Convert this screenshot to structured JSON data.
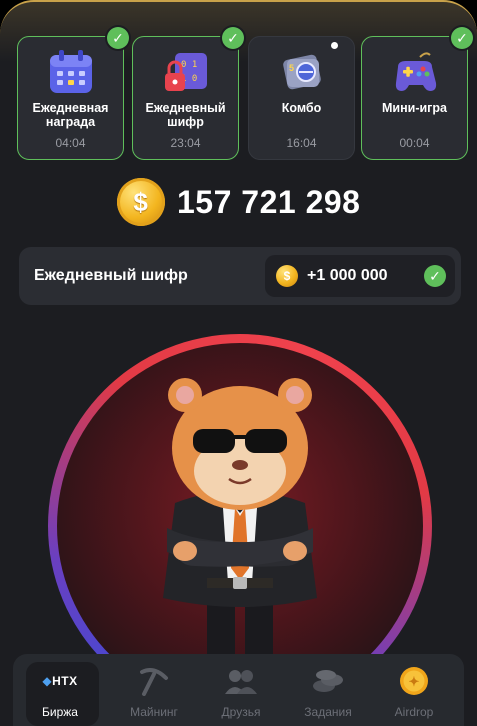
{
  "daily": {
    "cards": [
      {
        "label": "Ежедневная награда",
        "time": "04:04",
        "completed": true,
        "icon": "calendar-icon"
      },
      {
        "label": "Ежедневный шифр",
        "time": "23:04",
        "completed": true,
        "icon": "cipher-lock-icon"
      },
      {
        "label": "Комбо",
        "time": "16:04",
        "completed": false,
        "icon": "combo-card-icon"
      },
      {
        "label": "Мини-игра",
        "time": "00:04",
        "completed": true,
        "icon": "gamepad-icon"
      }
    ]
  },
  "balance": {
    "coin_symbol": "$",
    "amount": "157 721 298"
  },
  "cipher": {
    "title": "Ежедневный шифр",
    "reward": "+1 000 000",
    "coin_symbol": "$",
    "claimed": true
  },
  "nav": {
    "items": [
      {
        "label": "Биржа",
        "brand": "HTX",
        "active": true,
        "icon": "exchange-icon"
      },
      {
        "label": "Майнинг",
        "active": false,
        "icon": "pickaxe-icon"
      },
      {
        "label": "Друзья",
        "active": false,
        "icon": "friends-icon"
      },
      {
        "label": "Задания",
        "active": false,
        "icon": "coins-icon"
      },
      {
        "label": "Airdrop",
        "active": false,
        "icon": "airdrop-coin-icon"
      }
    ]
  },
  "colors": {
    "background": "#1c1d21",
    "card": "#2a2c32",
    "success": "#5fbf5b",
    "coin": "#f3b51f",
    "ring_red": "#e23a45",
    "ring_blue": "#3a4cd8"
  }
}
